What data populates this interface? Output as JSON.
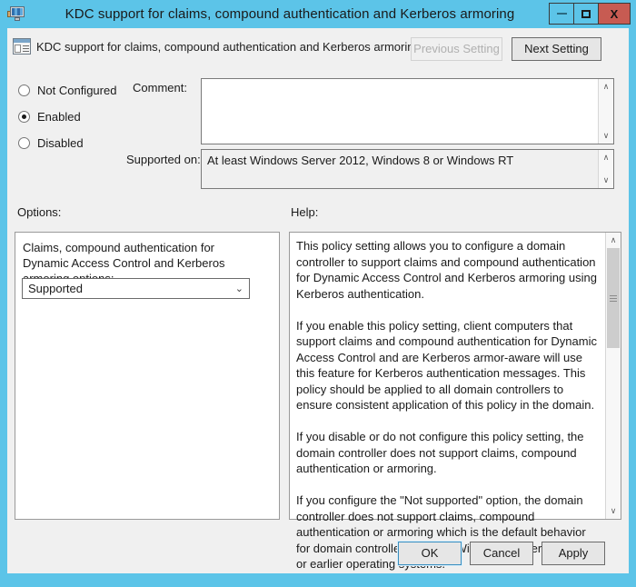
{
  "window": {
    "title": "KDC support for claims, compound authentication and Kerberos armoring",
    "title_icon": "computer-monitor-icon",
    "minimize_label": "–",
    "maximize_label": "□",
    "close_label": "X",
    "accent_color": "#5cc4e8",
    "close_color": "#c75b52",
    "body_color": "#f0f0f0"
  },
  "header": {
    "policy_icon": "policy-setting-icon",
    "policy_title": "KDC support for claims, compound authentication and Kerberos armoring",
    "previous_setting_label": "Previous Setting",
    "next_setting_label": "Next Setting",
    "previous_setting_enabled": false,
    "next_setting_enabled": true
  },
  "state": {
    "options": [
      {
        "label": "Not Configured",
        "selected": false
      },
      {
        "label": "Enabled",
        "selected": true
      },
      {
        "label": "Disabled",
        "selected": false
      }
    ]
  },
  "comment": {
    "label": "Comment:",
    "value": ""
  },
  "supported_on": {
    "label": "Supported on:",
    "value": "At least Windows Server 2012, Windows 8 or Windows RT"
  },
  "options_pane": {
    "label": "Options:",
    "setting_caption": "Claims, compound authentication for Dynamic Access Control and Kerberos armoring options:",
    "dropdown_value": "Supported",
    "dropdown_arrow": "⌄"
  },
  "help_pane": {
    "label": "Help:",
    "text": "This policy setting allows you to configure a domain controller to support claims and compound authentication for Dynamic Access Control and Kerberos armoring using Kerberos authentication.\n\nIf you enable this policy setting, client computers that support claims and compound authentication for Dynamic Access Control and are Kerberos armor-aware will use this feature for Kerberos authentication messages. This policy should be applied to all domain controllers to ensure consistent application of this policy in the domain.\n\nIf you disable or do not configure this policy setting, the domain controller does not support claims, compound authentication or armoring.\n\nIf you configure the \"Not supported\" option, the domain controller does not support claims, compound authentication or armoring which is the default behavior for domain controllers running Windows Server 2008 R2 or earlier operating systems."
  },
  "scrollbars": {
    "up_arrow": "∧",
    "down_arrow": "∨"
  },
  "footer": {
    "ok_label": "OK",
    "cancel_label": "Cancel",
    "apply_label": "Apply"
  }
}
